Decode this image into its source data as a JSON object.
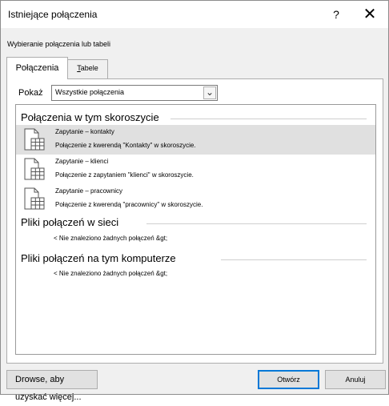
{
  "window": {
    "title": "Istniejące połączenia",
    "help_glyph": "?",
    "close_glyph": "✕"
  },
  "subtitle": "Wybieranie połączenia lub tabeli",
  "tabs": [
    {
      "label": "Połączenia",
      "active": true
    },
    {
      "label_prefix": "T",
      "label_rest": "abele",
      "active": false
    }
  ],
  "filter": {
    "label": "Pokaż",
    "value": "Wszystkie połączenia",
    "dropdown_glyph": "⌄"
  },
  "groups": [
    {
      "title": "Połączenia w tym skoroszycie",
      "items": [
        {
          "name": "Zapytanie – kontakty",
          "desc": "Połączenie z kwerendą \"Kontakty\" w skoroszycie.",
          "selected": true,
          "icon": "table-connection-icon"
        },
        {
          "name": "Zapytanie – klienci",
          "desc": "Połączenie z zapytaniem \"klienci\" w skoroszycie.",
          "selected": false,
          "icon": "table-connection-icon"
        },
        {
          "name": "Zapytanie – pracownicy",
          "desc": "Połączenie z kwerendą \"pracownicy\" w skoroszycie.",
          "selected": false,
          "icon": "table-connection-icon"
        }
      ]
    },
    {
      "title": "Pliki połączeń w sieci",
      "empty_message": "< Nie znaleziono żadnych połączeń &gt;"
    },
    {
      "title": "Pliki połączeń na tym komputerze",
      "empty_message": "< Nie znaleziono żadnych połączeń &gt;"
    }
  ],
  "buttons": {
    "browse": "Drowse, aby uzyskać więcej...",
    "open": "Otwórz",
    "cancel": "Anuluj"
  },
  "colors": {
    "selection": "#e0e0e0",
    "default_button_border": "#0078d7"
  }
}
